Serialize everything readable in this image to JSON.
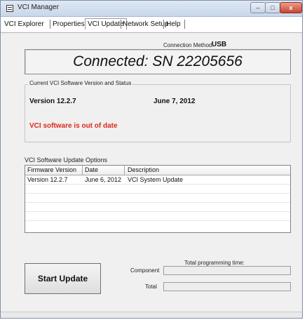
{
  "window": {
    "title": "VCI Manager",
    "controls": {
      "minimize": "–",
      "maximize": "□",
      "close": "x"
    }
  },
  "tabs": [
    {
      "label": "VCI Explorer",
      "active": false
    },
    {
      "label": "Properties",
      "active": false
    },
    {
      "label": "VCI Update",
      "active": true
    },
    {
      "label": "Network Setup",
      "active": false
    },
    {
      "label": "Help",
      "active": false
    }
  ],
  "connection": {
    "method_label": "Connection Method:",
    "method_value": "USB",
    "status_text": "Connected: SN 22205656"
  },
  "current": {
    "legend": "Current VCI Software Version and Status",
    "version": "Version 12.2.7",
    "date": "June 7, 2012",
    "status": "VCI software is out of date",
    "status_color": "#e0281c"
  },
  "update_options": {
    "label": "VCI Software Update Options",
    "columns": [
      "Firmware Version",
      "Date",
      "Description"
    ],
    "rows": [
      [
        "Version 12.2.7",
        "June 6, 2012",
        "VCI System Update"
      ]
    ]
  },
  "start_button": {
    "label": "Start Update"
  },
  "programming": {
    "title": "Total programming time:",
    "component_label": "Component",
    "total_label": "Total"
  }
}
